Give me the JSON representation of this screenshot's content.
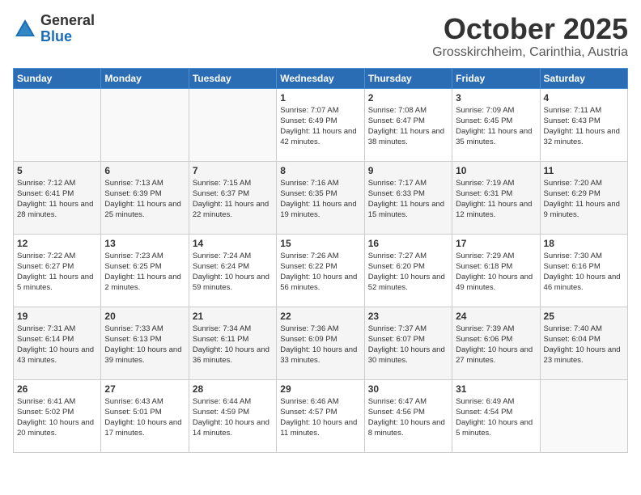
{
  "logo": {
    "general": "General",
    "blue": "Blue"
  },
  "title": "October 2025",
  "location": "Grosskirchheim, Carinthia, Austria",
  "weekdays": [
    "Sunday",
    "Monday",
    "Tuesday",
    "Wednesday",
    "Thursday",
    "Friday",
    "Saturday"
  ],
  "weeks": [
    [
      {
        "day": "",
        "sunrise": "",
        "sunset": "",
        "daylight": ""
      },
      {
        "day": "",
        "sunrise": "",
        "sunset": "",
        "daylight": ""
      },
      {
        "day": "",
        "sunrise": "",
        "sunset": "",
        "daylight": ""
      },
      {
        "day": "1",
        "sunrise": "Sunrise: 7:07 AM",
        "sunset": "Sunset: 6:49 PM",
        "daylight": "Daylight: 11 hours and 42 minutes."
      },
      {
        "day": "2",
        "sunrise": "Sunrise: 7:08 AM",
        "sunset": "Sunset: 6:47 PM",
        "daylight": "Daylight: 11 hours and 38 minutes."
      },
      {
        "day": "3",
        "sunrise": "Sunrise: 7:09 AM",
        "sunset": "Sunset: 6:45 PM",
        "daylight": "Daylight: 11 hours and 35 minutes."
      },
      {
        "day": "4",
        "sunrise": "Sunrise: 7:11 AM",
        "sunset": "Sunset: 6:43 PM",
        "daylight": "Daylight: 11 hours and 32 minutes."
      }
    ],
    [
      {
        "day": "5",
        "sunrise": "Sunrise: 7:12 AM",
        "sunset": "Sunset: 6:41 PM",
        "daylight": "Daylight: 11 hours and 28 minutes."
      },
      {
        "day": "6",
        "sunrise": "Sunrise: 7:13 AM",
        "sunset": "Sunset: 6:39 PM",
        "daylight": "Daylight: 11 hours and 25 minutes."
      },
      {
        "day": "7",
        "sunrise": "Sunrise: 7:15 AM",
        "sunset": "Sunset: 6:37 PM",
        "daylight": "Daylight: 11 hours and 22 minutes."
      },
      {
        "day": "8",
        "sunrise": "Sunrise: 7:16 AM",
        "sunset": "Sunset: 6:35 PM",
        "daylight": "Daylight: 11 hours and 19 minutes."
      },
      {
        "day": "9",
        "sunrise": "Sunrise: 7:17 AM",
        "sunset": "Sunset: 6:33 PM",
        "daylight": "Daylight: 11 hours and 15 minutes."
      },
      {
        "day": "10",
        "sunrise": "Sunrise: 7:19 AM",
        "sunset": "Sunset: 6:31 PM",
        "daylight": "Daylight: 11 hours and 12 minutes."
      },
      {
        "day": "11",
        "sunrise": "Sunrise: 7:20 AM",
        "sunset": "Sunset: 6:29 PM",
        "daylight": "Daylight: 11 hours and 9 minutes."
      }
    ],
    [
      {
        "day": "12",
        "sunrise": "Sunrise: 7:22 AM",
        "sunset": "Sunset: 6:27 PM",
        "daylight": "Daylight: 11 hours and 5 minutes."
      },
      {
        "day": "13",
        "sunrise": "Sunrise: 7:23 AM",
        "sunset": "Sunset: 6:25 PM",
        "daylight": "Daylight: 11 hours and 2 minutes."
      },
      {
        "day": "14",
        "sunrise": "Sunrise: 7:24 AM",
        "sunset": "Sunset: 6:24 PM",
        "daylight": "Daylight: 10 hours and 59 minutes."
      },
      {
        "day": "15",
        "sunrise": "Sunrise: 7:26 AM",
        "sunset": "Sunset: 6:22 PM",
        "daylight": "Daylight: 10 hours and 56 minutes."
      },
      {
        "day": "16",
        "sunrise": "Sunrise: 7:27 AM",
        "sunset": "Sunset: 6:20 PM",
        "daylight": "Daylight: 10 hours and 52 minutes."
      },
      {
        "day": "17",
        "sunrise": "Sunrise: 7:29 AM",
        "sunset": "Sunset: 6:18 PM",
        "daylight": "Daylight: 10 hours and 49 minutes."
      },
      {
        "day": "18",
        "sunrise": "Sunrise: 7:30 AM",
        "sunset": "Sunset: 6:16 PM",
        "daylight": "Daylight: 10 hours and 46 minutes."
      }
    ],
    [
      {
        "day": "19",
        "sunrise": "Sunrise: 7:31 AM",
        "sunset": "Sunset: 6:14 PM",
        "daylight": "Daylight: 10 hours and 43 minutes."
      },
      {
        "day": "20",
        "sunrise": "Sunrise: 7:33 AM",
        "sunset": "Sunset: 6:13 PM",
        "daylight": "Daylight: 10 hours and 39 minutes."
      },
      {
        "day": "21",
        "sunrise": "Sunrise: 7:34 AM",
        "sunset": "Sunset: 6:11 PM",
        "daylight": "Daylight: 10 hours and 36 minutes."
      },
      {
        "day": "22",
        "sunrise": "Sunrise: 7:36 AM",
        "sunset": "Sunset: 6:09 PM",
        "daylight": "Daylight: 10 hours and 33 minutes."
      },
      {
        "day": "23",
        "sunrise": "Sunrise: 7:37 AM",
        "sunset": "Sunset: 6:07 PM",
        "daylight": "Daylight: 10 hours and 30 minutes."
      },
      {
        "day": "24",
        "sunrise": "Sunrise: 7:39 AM",
        "sunset": "Sunset: 6:06 PM",
        "daylight": "Daylight: 10 hours and 27 minutes."
      },
      {
        "day": "25",
        "sunrise": "Sunrise: 7:40 AM",
        "sunset": "Sunset: 6:04 PM",
        "daylight": "Daylight: 10 hours and 23 minutes."
      }
    ],
    [
      {
        "day": "26",
        "sunrise": "Sunrise: 6:41 AM",
        "sunset": "Sunset: 5:02 PM",
        "daylight": "Daylight: 10 hours and 20 minutes."
      },
      {
        "day": "27",
        "sunrise": "Sunrise: 6:43 AM",
        "sunset": "Sunset: 5:01 PM",
        "daylight": "Daylight: 10 hours and 17 minutes."
      },
      {
        "day": "28",
        "sunrise": "Sunrise: 6:44 AM",
        "sunset": "Sunset: 4:59 PM",
        "daylight": "Daylight: 10 hours and 14 minutes."
      },
      {
        "day": "29",
        "sunrise": "Sunrise: 6:46 AM",
        "sunset": "Sunset: 4:57 PM",
        "daylight": "Daylight: 10 hours and 11 minutes."
      },
      {
        "day": "30",
        "sunrise": "Sunrise: 6:47 AM",
        "sunset": "Sunset: 4:56 PM",
        "daylight": "Daylight: 10 hours and 8 minutes."
      },
      {
        "day": "31",
        "sunrise": "Sunrise: 6:49 AM",
        "sunset": "Sunset: 4:54 PM",
        "daylight": "Daylight: 10 hours and 5 minutes."
      },
      {
        "day": "",
        "sunrise": "",
        "sunset": "",
        "daylight": ""
      }
    ]
  ]
}
